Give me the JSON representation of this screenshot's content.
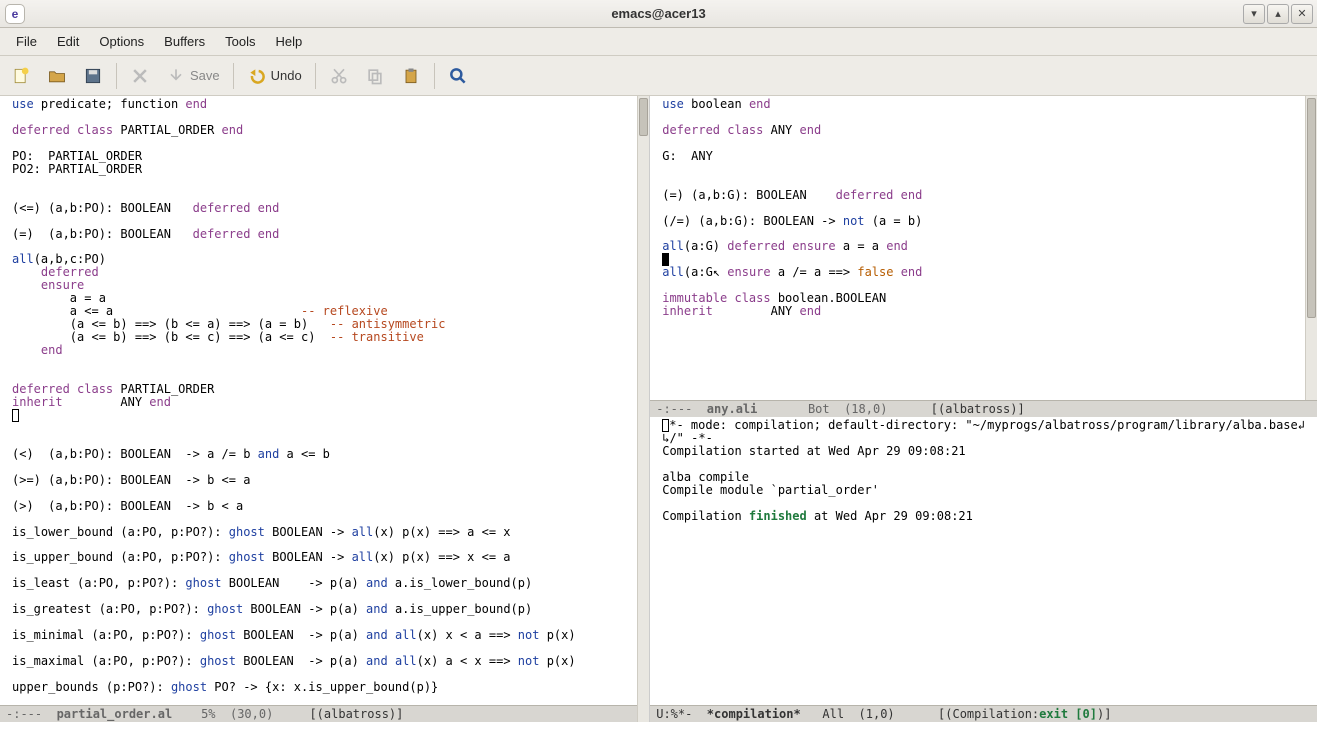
{
  "title": "emacs@acer13",
  "menubar": [
    "File",
    "Edit",
    "Options",
    "Buffers",
    "Tools",
    "Help"
  ],
  "toolbar": {
    "save_label": "Save",
    "undo_label": "Undo"
  },
  "modeline_left": {
    "flags": "-:---  ",
    "file": "partial_order.al",
    "pos": "5%  (30,0)",
    "mode": "[(albatross)]"
  },
  "modeline_right_top": {
    "flags": "-:---  ",
    "file": "any.ali",
    "pos": "Bot  (18,0)",
    "mode": "[(albatross)]"
  },
  "modeline_right_bottom": {
    "flags": "U:%*-  ",
    "file": "*compilation*",
    "pos": "All  (1,0)",
    "mode_prefix": "[(Compilation:",
    "mode_exit": "exit [0]",
    "mode_suffix": ")]"
  },
  "left_code": {
    "l1a": "use",
    "l1b": " predicate; function ",
    "l1c": "end",
    "l2a": "deferred class",
    "l2b": " PARTIAL_ORDER ",
    "l2c": "end",
    "l3": "PO:  PARTIAL_ORDER",
    "l4": "PO2: PARTIAL_ORDER",
    "l5": "(<=) (a,b:PO): BOOLEAN   ",
    "l5b": "deferred end",
    "l6": "(=)  (a,b:PO): BOOLEAN   ",
    "l6b": "deferred end",
    "l7a": "all",
    "l7b": "(a,b,c:PO)",
    "l8": "deferred",
    "l9": "ensure",
    "l10": "        a = a",
    "l11": "        a <= a                          ",
    "l11c": "-- reflexive",
    "l12": "        (a <= b) ==> (b <= a) ==> (a = b)   ",
    "l12c": "-- antisymmetric",
    "l13": "        (a <= b) ==> (b <= c) ==> (a <= c)  ",
    "l13c": "-- transitive",
    "l14": "end",
    "l15a": "deferred class",
    "l15b": " PARTIAL_ORDER",
    "l16a": "inherit",
    "l16b": "        ANY ",
    "l16c": "end",
    "l18": "(<)  (a,b:PO): BOOLEAN  -> a /= b ",
    "l18b": "and",
    "l18c": " a <= b",
    "l19": "(>=) (a,b:PO): BOOLEAN  -> b <= a",
    "l20": "(>)  (a,b:PO): BOOLEAN  -> b < a",
    "l21a": "is_lower_bound (a:PO, p:PO?): ",
    "l21b": "ghost",
    "l21c": " BOOLEAN -> ",
    "l21d": "all",
    "l21e": "(x) p(x) ==> a <= x",
    "l22a": "is_upper_bound (a:PO, p:PO?): ",
    "l22b": "ghost",
    "l22c": " BOOLEAN -> ",
    "l22d": "all",
    "l22e": "(x) p(x) ==> x <= a",
    "l23a": "is_least (a:PO, p:PO?): ",
    "l23b": "ghost",
    "l23c": " BOOLEAN    -> p(a) ",
    "l23d": "and",
    "l23e": " a.is_lower_bound(p)",
    "l24a": "is_greatest (a:PO, p:PO?): ",
    "l24b": "ghost",
    "l24c": " BOOLEAN -> p(a) ",
    "l24d": "and",
    "l24e": " a.is_upper_bound(p)",
    "l25a": "is_minimal (a:PO, p:PO?): ",
    "l25b": "ghost",
    "l25c": " BOOLEAN  -> p(a) ",
    "l25d": "and",
    "l25e": " ",
    "l25f": "all",
    "l25g": "(x) x < a ==> ",
    "l25h": "not",
    "l25i": " p(x)",
    "l26a": "is_maximal (a:PO, p:PO?): ",
    "l26b": "ghost",
    "l26c": " BOOLEAN  -> p(a) ",
    "l26d": "and",
    "l26e": " ",
    "l26f": "all",
    "l26g": "(x) a < x ==> ",
    "l26h": "not",
    "l26i": " p(x)",
    "l27a": "upper_bounds (p:PO?): ",
    "l27b": "ghost",
    "l27c": " PO? -> {x: x.is_upper_bound(p)}"
  },
  "right_code": {
    "l1a": "use",
    "l1b": " boolean ",
    "l1c": "end",
    "l2a": "deferred class",
    "l2b": " ANY ",
    "l2c": "end",
    "l3": "G:  ANY",
    "l4": "(=) (a,b:G): BOOLEAN    ",
    "l4b": "deferred end",
    "l5": "(/=) (a,b:G): BOOLEAN -> ",
    "l5b": "not",
    "l5c": " (a = b)",
    "l6a": "all",
    "l6b": "(a:G) ",
    "l6c": "deferred ensure",
    "l6d": " a = a ",
    "l6e": "end",
    "l7a": "all",
    "l7b": "(a:G",
    "l7cur": "",
    "l7c": " ",
    "l7d": "ensure",
    "l7e": " a /= a ==> ",
    "l7f": "false",
    "l7g": " ",
    "l7h": "end",
    "l8a": "immutable class",
    "l8b": " boolean.BOOLEAN",
    "l9a": "inherit",
    "l9b": "        ANY ",
    "l9c": "end"
  },
  "compilation": {
    "l1": "*- mode: compilation; default-directory: \"~/myprogs/albatross/program/library/alba.base",
    "l1tail": "/\" -*-",
    "l2": "Compilation started at Wed Apr 29 09:08:21",
    "l3": "alba compile",
    "l4": "Compile module `partial_order'",
    "l5a": "Compilation ",
    "l5b": "finished",
    "l5c": " at Wed Apr 29 09:08:21"
  }
}
